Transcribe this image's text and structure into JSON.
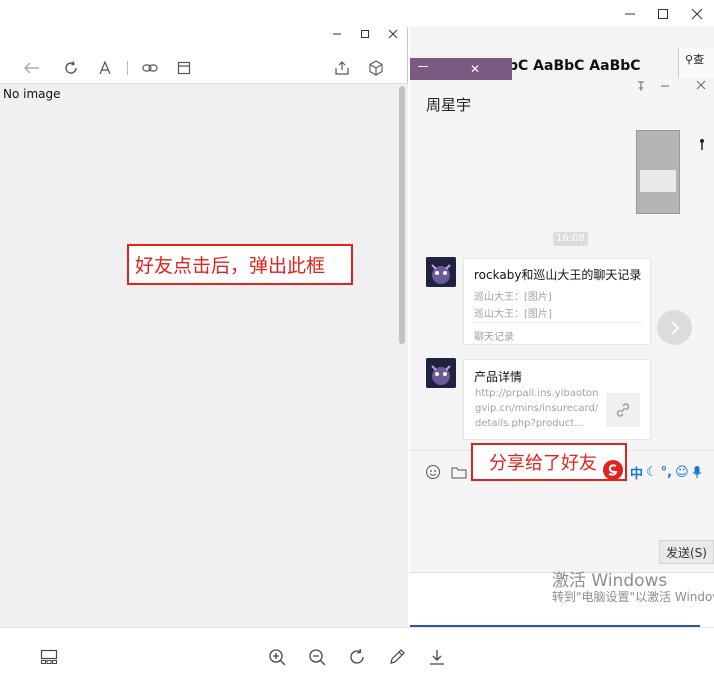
{
  "viewer": {
    "no_image_text": "No image",
    "annotation_popup": "好友点击后，弹出此框"
  },
  "word": {
    "styles_text": "bC AaBbC AaBbC",
    "side_label": "查"
  },
  "chat": {
    "title": "周星宇",
    "timestamp": "16:08",
    "card1": {
      "title": "rockaby和巡山大王的聊天记录",
      "line1": "巡山大王：[图片]",
      "line2": "巡山大王：[图片]",
      "footer": "聊天记录"
    },
    "card2": {
      "title": "产品详情",
      "url": "http://prpall.ins.yibaotongvip.cn/mins/insurecard/details.php?product..."
    },
    "annotation_share": "分享给了好友",
    "send_button": "发送(S)",
    "ime_label": "中"
  },
  "watermark": {
    "title": "激活 Windows",
    "subtitle": "转到\"电脑设置\"以激活 Windows"
  },
  "colors": {
    "annotation_red": "#e0231c",
    "word_blue": "#2b579a",
    "ime_blue": "#1976d2"
  }
}
